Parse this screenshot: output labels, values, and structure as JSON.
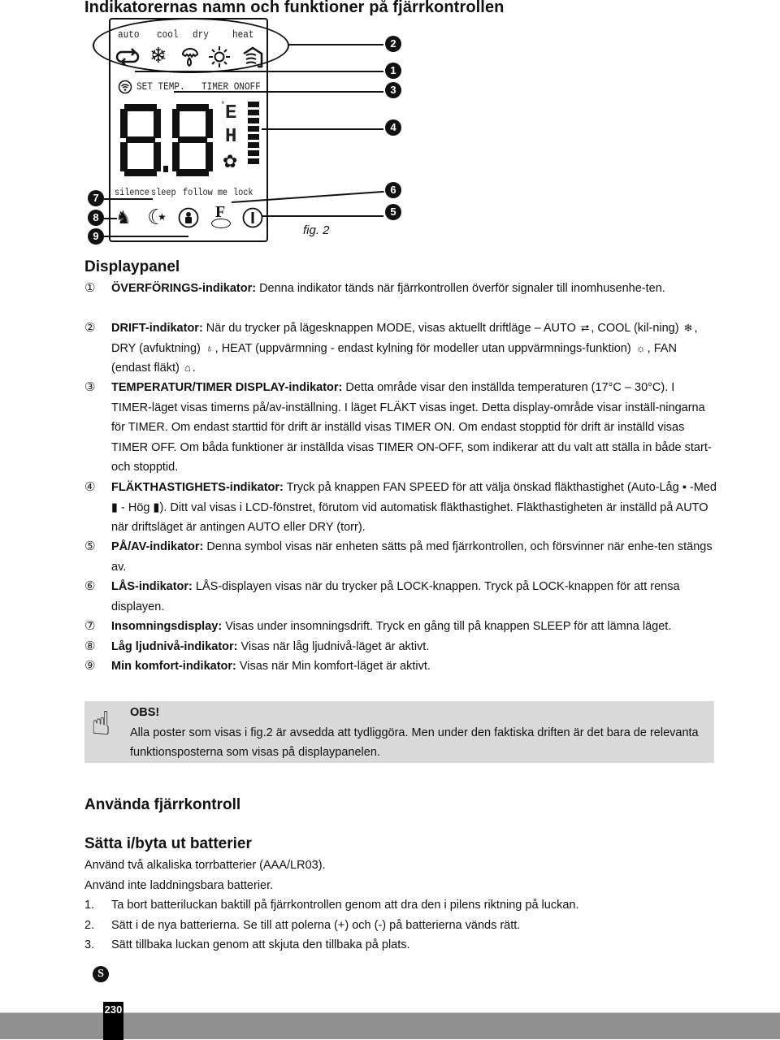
{
  "page_title": "Indikatorernas namn och funktioner på fjärrkontrollen",
  "figure": {
    "mode_labels": [
      "auto",
      "cool",
      "dry",
      "heat"
    ],
    "mode_icons": [
      "auto-cycle-icon",
      "snowflake-icon",
      "dry-drop-icon",
      "sun-icon",
      "fan-only-icon"
    ],
    "set_temp_label": "SET TEMP.",
    "timer_label": "TIMER ONOFF",
    "digit_display": "8.8",
    "degree_symbol": "°",
    "unit_letters": [
      "E",
      "H"
    ],
    "fan_speed_levels": 8,
    "bottom_labels": [
      "silence",
      "sleep",
      "follow me",
      "lock"
    ],
    "lock_glyph": "F",
    "power_glyph": "|",
    "caption": "fig. 2",
    "callouts": [
      "2",
      "1",
      "3",
      "4",
      "6",
      "5",
      "7",
      "8",
      "9"
    ]
  },
  "displaypanel": {
    "heading": "Displaypanel",
    "items": [
      {
        "num": "①",
        "term": "ÖVERFÖRINGS-indikator:",
        "text": " Denna indikator tänds när fjärrkontrollen överför signaler till inomhusenhe-ten."
      },
      {
        "num": "②",
        "term": "DRIFT-indikator:",
        "text_parts": [
          " När du trycker på lägesknappen MODE, visas aktuellt driftläge – AUTO ",
          ", COOL (kil-ning) ",
          ",  DRY (avfuktning) ",
          ", HEAT (uppvärmning - endast kylning för modeller utan uppvärmnings-funktion) ",
          ", FAN (endast fläkt) ",
          "."
        ],
        "icons": [
          "⮂",
          "❄",
          "♁",
          "☼",
          "⌂"
        ]
      },
      {
        "num": "③",
        "term": "TEMPERATUR/TIMER DISPLAY-indikator:",
        "text": " Detta område visar den inställda temperaturen (17°C – 30°C). I TIMER-läget visas timerns på/av-inställning. I läget FLÄKT visas inget. Detta display-område visar inställ-ningarna för TIMER. Om endast starttid för drift är inställd visas TIMER ON. Om endast stopptid för drift är inställd visas TIMER OFF. Om båda funktioner är inställda visas TIMER ON-OFF, som indikerar att du valt att ställa in både start- och stopptid."
      },
      {
        "num": "④",
        "term": "FLÄKTHASTIGHETS-indikator:",
        "text": " Tryck på knappen FAN SPEED för att välja önskad fläkthastighet (Auto-Låg ▪ -Med ▮ - Hög ▮). Ditt val visas i LCD-fönstret, förutom vid automatisk fläkthastighet. Fläkthastigheten är inställd på AUTO när driftsläget är antingen AUTO eller DRY (torr)."
      },
      {
        "num": "⑤",
        "term": "PÅ/AV-indikator:",
        "text": " Denna symbol visas när enheten sätts på med fjärrkontrollen, och försvinner när enhe-ten stängs av."
      },
      {
        "num": "⑥",
        "term": "LÅS-indikator:",
        "text": " LÅS-displayen visas när du trycker på LOCK-knappen. Tryck på LOCK-knappen för att rensa displayen."
      },
      {
        "num": "⑦",
        "term": "Insomningsdisplay:",
        "text": " Visas under insomningsdrift. Tryck en gång till på knappen SLEEP för att lämna läget."
      },
      {
        "num": "⑧",
        "term": "Låg ljudnivå-indikator:",
        "text": " Visas när låg ljudnivå-läget är aktivt."
      },
      {
        "num": "⑨",
        "term": "Min komfort-indikator:",
        "text": " Visas när Min komfort-läget är aktivt."
      }
    ]
  },
  "note": {
    "icon": "pointing-hand-icon",
    "title": "OBS!",
    "text": "Alla poster som visas i fig.2 är avsedda att tydliggöra. Men under den faktiska driften är det bara de relevanta funktionsposterna som visas på displaypanelen."
  },
  "remote_section": {
    "heading": "Använda fjärrkontroll"
  },
  "battery_section": {
    "heading": "Sätta i/byta ut batterier",
    "paragraphs": [
      "Använd två alkaliska torrbatterier (AAA/LR03).",
      "Använd inte laddningsbara batterier."
    ],
    "steps": [
      {
        "n": "1.",
        "text": "Ta bort batteriluckan baktill på fjärrkontrollen genom att dra den i pilens riktning på luckan."
      },
      {
        "n": "2.",
        "text": "Sätt i de nya batterierna. Se till att polerna (+) och (-) på batterierna vänds rätt."
      },
      {
        "n": "3.",
        "text": "Sätt tillbaka luckan genom att skjuta den tillbaka på plats."
      }
    ]
  },
  "footer": {
    "language_badge": "S",
    "page_number": "230"
  }
}
